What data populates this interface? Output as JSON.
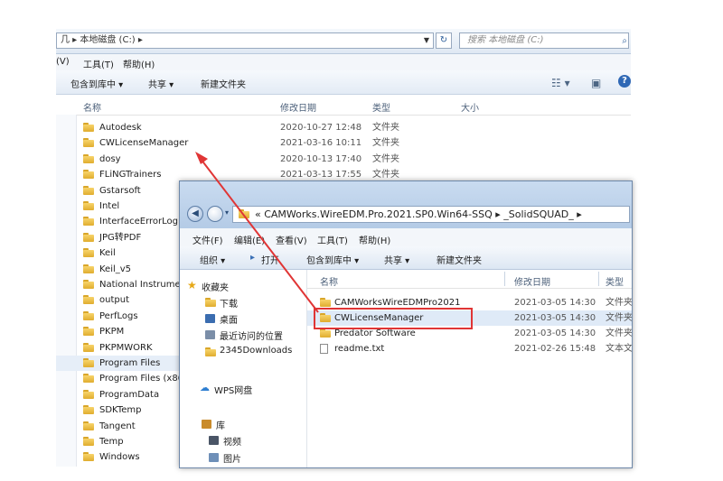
{
  "back_window": {
    "address": "几 ▸ 本地磁盘 (C:) ▸",
    "search_placeholder": "搜索 本地磁盘 (C:)",
    "menu": [
      "(V)",
      "工具(T)",
      "帮助(H)"
    ],
    "toolbar": [
      "包含到库中 ▾",
      "共享 ▾",
      "新建文件夹"
    ],
    "columns": {
      "name": "名称",
      "date": "修改日期",
      "type": "类型",
      "size": "大小"
    },
    "folders": [
      {
        "name": "Autodesk",
        "date": "2020-10-27 12:48",
        "type": "文件夹"
      },
      {
        "name": "CWLicenseManager",
        "date": "2021-03-16 10:11",
        "type": "文件夹"
      },
      {
        "name": "dosy",
        "date": "2020-10-13 17:40",
        "type": "文件夹"
      },
      {
        "name": "FLiNGTrainers",
        "date": "2021-03-13 17:55",
        "type": "文件夹"
      },
      {
        "name": "Gstarsoft",
        "date": "",
        "type": ""
      },
      {
        "name": "Intel",
        "date": "",
        "type": ""
      },
      {
        "name": "InterfaceErrorLog",
        "date": "",
        "type": ""
      },
      {
        "name": "JPG转PDF",
        "date": "",
        "type": ""
      },
      {
        "name": "Keil",
        "date": "",
        "type": ""
      },
      {
        "name": "Keil_v5",
        "date": "",
        "type": ""
      },
      {
        "name": "National Instrume",
        "date": "",
        "type": ""
      },
      {
        "name": "output",
        "date": "",
        "type": ""
      },
      {
        "name": "PerfLogs",
        "date": "",
        "type": ""
      },
      {
        "name": "PKPM",
        "date": "",
        "type": ""
      },
      {
        "name": "PKPMWORK",
        "date": "",
        "type": ""
      },
      {
        "name": "Program Files",
        "date": "",
        "type": ""
      },
      {
        "name": "Program Files (x86",
        "date": "",
        "type": ""
      },
      {
        "name": "ProgramData",
        "date": "",
        "type": ""
      },
      {
        "name": "SDKTemp",
        "date": "",
        "type": ""
      },
      {
        "name": "Tangent",
        "date": "",
        "type": ""
      },
      {
        "name": "Temp",
        "date": "",
        "type": ""
      },
      {
        "name": "Windows",
        "date": "",
        "type": ""
      }
    ]
  },
  "front_window": {
    "address": "« CAMWorks.WireEDM.Pro.2021.SP0.Win64-SSQ ▸ _SolidSQUAD_ ▸",
    "menu": [
      "文件(F)",
      "编辑(E)",
      "查看(V)",
      "工具(T)",
      "帮助(H)"
    ],
    "toolbar": [
      "组织 ▾",
      "打开",
      "包含到库中 ▾",
      "共享 ▾",
      "新建文件夹"
    ],
    "nav": {
      "favorites": "收藏夹",
      "downloads": "下载",
      "desktop": "桌面",
      "recent": "最近访问的位置",
      "downloads2345": "2345Downloads",
      "wps": "WPS网盘",
      "library": "库",
      "video": "视频",
      "pictures": "图片"
    },
    "columns": {
      "name": "名称",
      "date": "修改日期",
      "type": "类型"
    },
    "files": [
      {
        "name": "CAMWorksWireEDMPro2021",
        "date": "2021-03-05 14:30",
        "type": "文件夹",
        "kind": "folder"
      },
      {
        "name": "CWLicenseManager",
        "date": "2021-03-05 14:30",
        "type": "文件夹",
        "kind": "folder"
      },
      {
        "name": "Predator Software",
        "date": "2021-03-05 14:30",
        "type": "文件夹",
        "kind": "folder"
      },
      {
        "name": "readme.txt",
        "date": "2021-02-26 15:48",
        "type": "文本文",
        "kind": "text"
      }
    ]
  },
  "annotation_color": "#e03535"
}
